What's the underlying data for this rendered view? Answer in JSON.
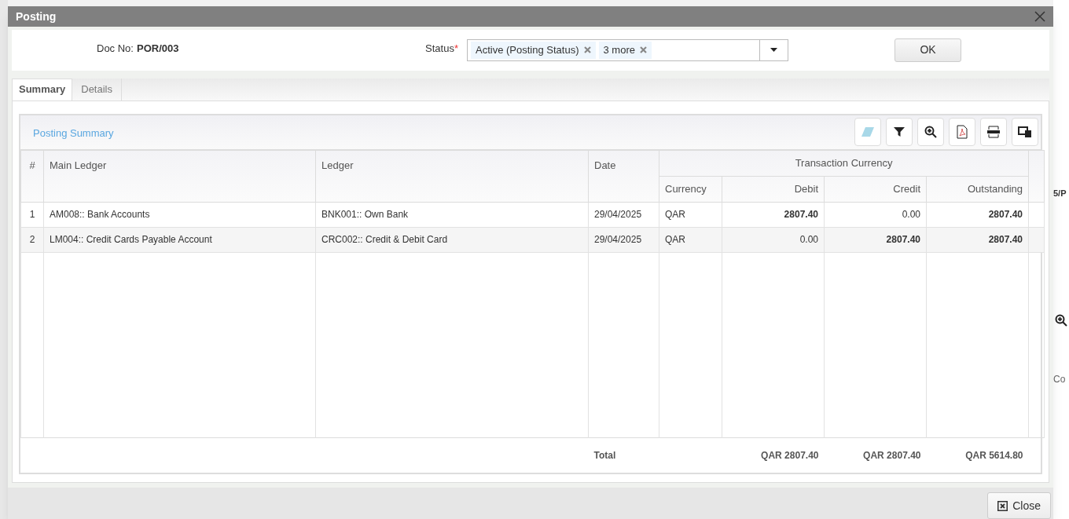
{
  "background": {
    "fragments": [
      "5/P",
      "Co"
    ]
  },
  "dialog": {
    "title": "Posting",
    "doc_no_label": "Doc No:",
    "doc_no": "POR/003",
    "status_label": "Status",
    "required_mark": "*",
    "status_tags": [
      "Active (Posting Status)",
      "3 more"
    ],
    "ok_button": "OK",
    "close_button": "Close"
  },
  "tabs": [
    {
      "label": "Summary",
      "selected": true
    },
    {
      "label": "Details",
      "selected": false
    }
  ],
  "grid": {
    "title": "Posting Summary",
    "columns": [
      "#",
      "Main Ledger",
      "Ledger",
      "Date"
    ],
    "group_header": "Transaction Currency",
    "sub_columns": [
      "Currency",
      "Debit",
      "Credit",
      "Outstanding"
    ],
    "rows": [
      {
        "cells": [
          {
            "text": "1",
            "bold": false
          },
          {
            "text": "AM008:: Bank Accounts",
            "bold": false
          },
          {
            "text": "BNK001:: Own Bank",
            "bold": false
          },
          {
            "text": "29/04/2025",
            "bold": false
          },
          {
            "text": "QAR",
            "bold": false
          },
          {
            "text": "2807.40",
            "bold": true
          },
          {
            "text": "0.00",
            "bold": false
          },
          {
            "text": "2807.40",
            "bold": true
          }
        ]
      },
      {
        "cells": [
          {
            "text": "2",
            "bold": false
          },
          {
            "text": "LM004:: Credit Cards Payable Account",
            "bold": false
          },
          {
            "text": "CRC002:: Credit & Debit Card",
            "bold": false
          },
          {
            "text": "29/04/2025",
            "bold": false
          },
          {
            "text": "QAR",
            "bold": false
          },
          {
            "text": "0.00",
            "bold": false
          },
          {
            "text": "2807.40",
            "bold": true
          },
          {
            "text": "2807.40",
            "bold": true
          }
        ]
      }
    ],
    "total_label": "Total",
    "totals": [
      "QAR 2807.40",
      "QAR 2807.40",
      "QAR 5614.80"
    ]
  }
}
